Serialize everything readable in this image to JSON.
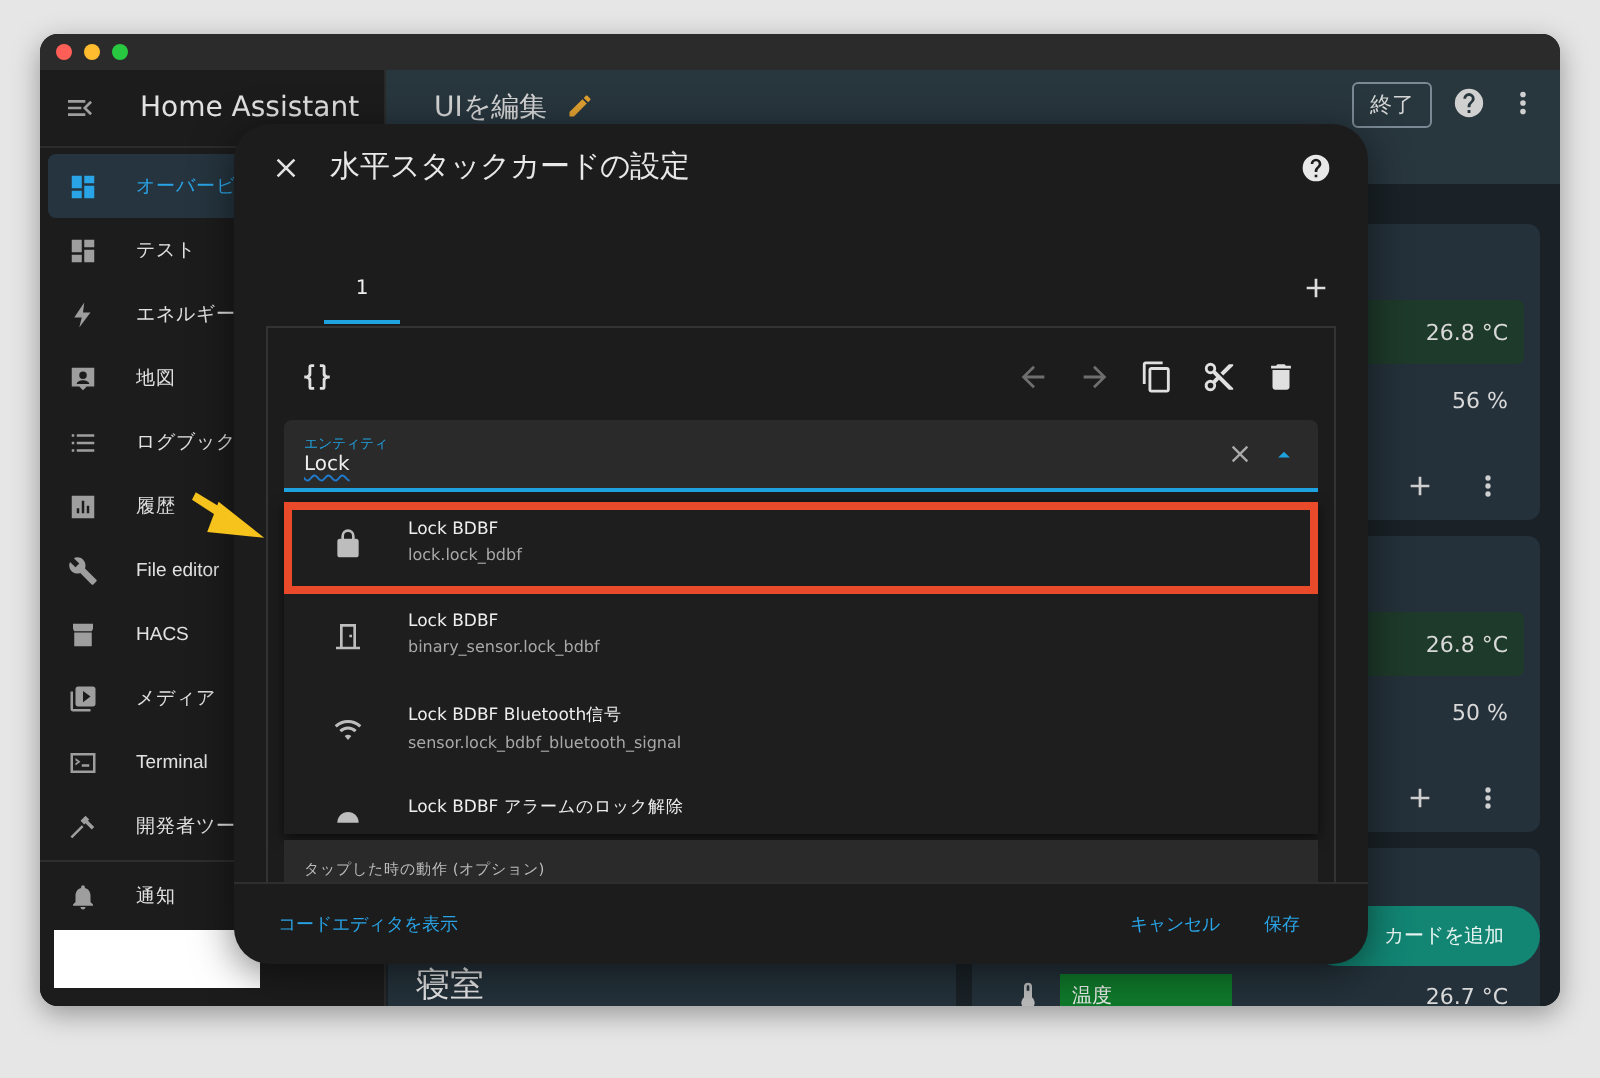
{
  "sidebar": {
    "title": "Home Assistant",
    "items": [
      {
        "label": "オーバービ",
        "kind": "dashboard",
        "selected": true
      },
      {
        "label": "テスト",
        "kind": "dashboard",
        "selected": false
      },
      {
        "label": "エネルギー",
        "kind": "bolt",
        "selected": false
      },
      {
        "label": "地図",
        "kind": "account",
        "selected": false
      },
      {
        "label": "ログブック",
        "kind": "list",
        "selected": false
      },
      {
        "label": "履歴",
        "kind": "chart",
        "selected": false
      },
      {
        "label": "File editor",
        "kind": "wrench",
        "selected": false
      },
      {
        "label": "HACS",
        "kind": "store",
        "selected": false
      },
      {
        "label": "メディア",
        "kind": "media",
        "selected": false
      },
      {
        "label": "Terminal",
        "kind": "terminal",
        "selected": false
      },
      {
        "label": "開発者ツー",
        "kind": "hammer",
        "selected": false
      }
    ],
    "notifications": {
      "label": "通知"
    }
  },
  "topbar": {
    "title": "UIを編集",
    "done_button": "終了"
  },
  "dashboard": {
    "right_cards": [
      {
        "rows": [
          {
            "value": "26.8 °C",
            "kind": "green"
          },
          {
            "value": "56 %",
            "kind": "plain"
          }
        ]
      },
      {
        "rows": [
          {
            "value": "26.8 °C",
            "kind": "green"
          },
          {
            "value": "50 %",
            "kind": "plain"
          }
        ]
      }
    ],
    "bottom_left_card": {
      "title": "寝室"
    },
    "bottom_right_card": {
      "label": "温度",
      "value": "26.7 °C"
    },
    "add_card_button": "カードを追加"
  },
  "dialog": {
    "title": "水平スタックカードの設定",
    "tabs": [
      {
        "label": "1",
        "selected": true
      }
    ],
    "toolbar": [
      {
        "kind": "left",
        "disabled": true
      },
      {
        "kind": "right",
        "disabled": true
      },
      {
        "kind": "copy",
        "disabled": false
      },
      {
        "kind": "cut",
        "disabled": false
      },
      {
        "kind": "delete",
        "disabled": false
      }
    ],
    "entity_field": {
      "label": "エンティティ",
      "value": "Lock"
    },
    "options": [
      {
        "kind": "lock",
        "name": "Lock BDBF",
        "entity_id": "lock.lock_bdbf",
        "highlighted": true
      },
      {
        "kind": "door",
        "name": "Lock BDBF",
        "entity_id": "binary_sensor.lock_bdbf",
        "highlighted": false
      },
      {
        "kind": "wifi",
        "name": "Lock BDBF Bluetooth信号",
        "entity_id": "sensor.lock_bdbf_bluetooth_signal",
        "highlighted": false
      },
      {
        "kind": "alarm",
        "name": "Lock BDBF アラームのロック解除",
        "highlighted": false
      }
    ],
    "tap_action_field": {
      "label": "タップした時の動作 (オプション)"
    },
    "footer": {
      "code_editor_link": "コードエディタを表示",
      "cancel_button": "キャンセル",
      "save_button": "保存"
    }
  }
}
